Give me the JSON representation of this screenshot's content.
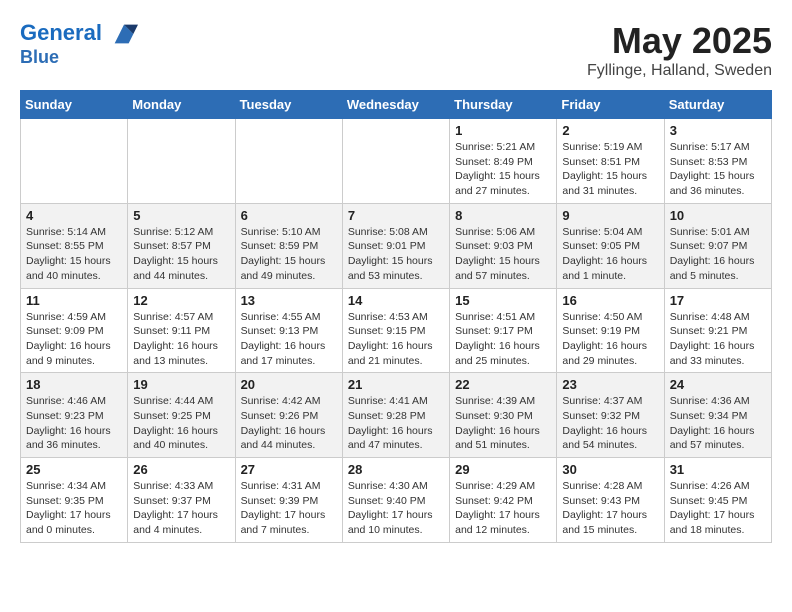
{
  "header": {
    "logo_line1": "General",
    "logo_line2": "Blue",
    "month": "May 2025",
    "location": "Fyllinge, Halland, Sweden"
  },
  "weekdays": [
    "Sunday",
    "Monday",
    "Tuesday",
    "Wednesday",
    "Thursday",
    "Friday",
    "Saturday"
  ],
  "weeks": [
    [
      {
        "day": "",
        "info": ""
      },
      {
        "day": "",
        "info": ""
      },
      {
        "day": "",
        "info": ""
      },
      {
        "day": "",
        "info": ""
      },
      {
        "day": "1",
        "info": "Sunrise: 5:21 AM\nSunset: 8:49 PM\nDaylight: 15 hours\nand 27 minutes."
      },
      {
        "day": "2",
        "info": "Sunrise: 5:19 AM\nSunset: 8:51 PM\nDaylight: 15 hours\nand 31 minutes."
      },
      {
        "day": "3",
        "info": "Sunrise: 5:17 AM\nSunset: 8:53 PM\nDaylight: 15 hours\nand 36 minutes."
      }
    ],
    [
      {
        "day": "4",
        "info": "Sunrise: 5:14 AM\nSunset: 8:55 PM\nDaylight: 15 hours\nand 40 minutes."
      },
      {
        "day": "5",
        "info": "Sunrise: 5:12 AM\nSunset: 8:57 PM\nDaylight: 15 hours\nand 44 minutes."
      },
      {
        "day": "6",
        "info": "Sunrise: 5:10 AM\nSunset: 8:59 PM\nDaylight: 15 hours\nand 49 minutes."
      },
      {
        "day": "7",
        "info": "Sunrise: 5:08 AM\nSunset: 9:01 PM\nDaylight: 15 hours\nand 53 minutes."
      },
      {
        "day": "8",
        "info": "Sunrise: 5:06 AM\nSunset: 9:03 PM\nDaylight: 15 hours\nand 57 minutes."
      },
      {
        "day": "9",
        "info": "Sunrise: 5:04 AM\nSunset: 9:05 PM\nDaylight: 16 hours\nand 1 minute."
      },
      {
        "day": "10",
        "info": "Sunrise: 5:01 AM\nSunset: 9:07 PM\nDaylight: 16 hours\nand 5 minutes."
      }
    ],
    [
      {
        "day": "11",
        "info": "Sunrise: 4:59 AM\nSunset: 9:09 PM\nDaylight: 16 hours\nand 9 minutes."
      },
      {
        "day": "12",
        "info": "Sunrise: 4:57 AM\nSunset: 9:11 PM\nDaylight: 16 hours\nand 13 minutes."
      },
      {
        "day": "13",
        "info": "Sunrise: 4:55 AM\nSunset: 9:13 PM\nDaylight: 16 hours\nand 17 minutes."
      },
      {
        "day": "14",
        "info": "Sunrise: 4:53 AM\nSunset: 9:15 PM\nDaylight: 16 hours\nand 21 minutes."
      },
      {
        "day": "15",
        "info": "Sunrise: 4:51 AM\nSunset: 9:17 PM\nDaylight: 16 hours\nand 25 minutes."
      },
      {
        "day": "16",
        "info": "Sunrise: 4:50 AM\nSunset: 9:19 PM\nDaylight: 16 hours\nand 29 minutes."
      },
      {
        "day": "17",
        "info": "Sunrise: 4:48 AM\nSunset: 9:21 PM\nDaylight: 16 hours\nand 33 minutes."
      }
    ],
    [
      {
        "day": "18",
        "info": "Sunrise: 4:46 AM\nSunset: 9:23 PM\nDaylight: 16 hours\nand 36 minutes."
      },
      {
        "day": "19",
        "info": "Sunrise: 4:44 AM\nSunset: 9:25 PM\nDaylight: 16 hours\nand 40 minutes."
      },
      {
        "day": "20",
        "info": "Sunrise: 4:42 AM\nSunset: 9:26 PM\nDaylight: 16 hours\nand 44 minutes."
      },
      {
        "day": "21",
        "info": "Sunrise: 4:41 AM\nSunset: 9:28 PM\nDaylight: 16 hours\nand 47 minutes."
      },
      {
        "day": "22",
        "info": "Sunrise: 4:39 AM\nSunset: 9:30 PM\nDaylight: 16 hours\nand 51 minutes."
      },
      {
        "day": "23",
        "info": "Sunrise: 4:37 AM\nSunset: 9:32 PM\nDaylight: 16 hours\nand 54 minutes."
      },
      {
        "day": "24",
        "info": "Sunrise: 4:36 AM\nSunset: 9:34 PM\nDaylight: 16 hours\nand 57 minutes."
      }
    ],
    [
      {
        "day": "25",
        "info": "Sunrise: 4:34 AM\nSunset: 9:35 PM\nDaylight: 17 hours\nand 0 minutes."
      },
      {
        "day": "26",
        "info": "Sunrise: 4:33 AM\nSunset: 9:37 PM\nDaylight: 17 hours\nand 4 minutes."
      },
      {
        "day": "27",
        "info": "Sunrise: 4:31 AM\nSunset: 9:39 PM\nDaylight: 17 hours\nand 7 minutes."
      },
      {
        "day": "28",
        "info": "Sunrise: 4:30 AM\nSunset: 9:40 PM\nDaylight: 17 hours\nand 10 minutes."
      },
      {
        "day": "29",
        "info": "Sunrise: 4:29 AM\nSunset: 9:42 PM\nDaylight: 17 hours\nand 12 minutes."
      },
      {
        "day": "30",
        "info": "Sunrise: 4:28 AM\nSunset: 9:43 PM\nDaylight: 17 hours\nand 15 minutes."
      },
      {
        "day": "31",
        "info": "Sunrise: 4:26 AM\nSunset: 9:45 PM\nDaylight: 17 hours\nand 18 minutes."
      }
    ]
  ]
}
